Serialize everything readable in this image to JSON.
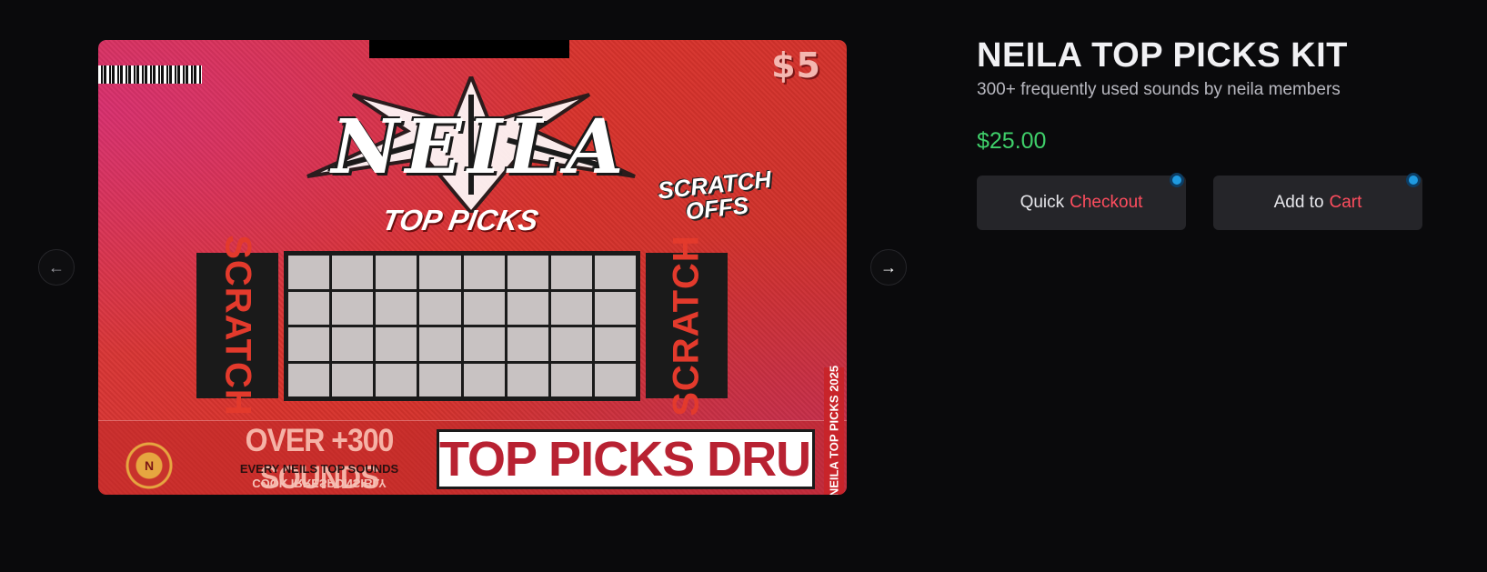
{
  "product": {
    "title": "NEILA TOP PICKS KIT",
    "subtitle": "300+ frequently used sounds by neila members",
    "price": "$25.00"
  },
  "buttons": {
    "quick_checkout_prefix": "Quick",
    "quick_checkout_accent": "Checkout",
    "add_to_cart_prefix": "Add to",
    "add_to_cart_accent": "Cart"
  },
  "carousel": {
    "prev_icon": "arrow-left-icon",
    "next_icon": "arrow-right-icon"
  },
  "artwork": {
    "price_tag": "$5",
    "logo_text": "NEILA",
    "top_picks": "TOP PICKS",
    "scratch_offs": "SCRATCH OFFS",
    "scratch_left": "SCRATCH",
    "scratch_right": "SCRATCH",
    "over_sounds": "OVER +300 SOUNDS",
    "every_text": "EVERY NEILS TOP SOUNDS",
    "cook_text": "COOK IRRESPONSIBLY",
    "drum_kit": "TOP PICKS DRUM KIT",
    "vertical_year": "NEILA TOP PICKS 2025",
    "badge_letter": "N"
  },
  "colors": {
    "background": "#0a0a0c",
    "price_green": "#3fcf6a",
    "accent_red": "#ff4d5e",
    "button_bg": "#252529",
    "indicator_blue": "#1f9ae0"
  }
}
